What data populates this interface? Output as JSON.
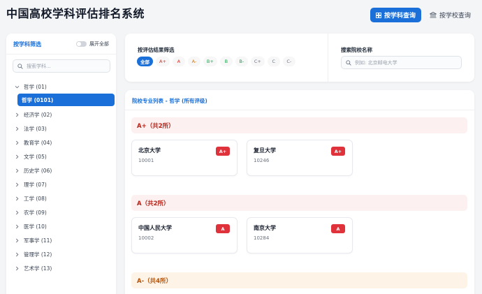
{
  "app": {
    "title": "中国高校学科评估排名系统"
  },
  "nav": {
    "subject_query": "按学科查询",
    "school_query": "按学校查询"
  },
  "sidebar": {
    "title": "按学科筛选",
    "expand_all": "展开全部",
    "search_placeholder": "搜索学科...",
    "tree": [
      {
        "label": "哲学 (01)",
        "expanded": true,
        "children": [
          {
            "label": "哲学 (0101)",
            "selected": true
          }
        ]
      },
      {
        "label": "经济学 (02)"
      },
      {
        "label": "法学 (03)"
      },
      {
        "label": "教育学 (04)"
      },
      {
        "label": "文学 (05)"
      },
      {
        "label": "历史学 (06)"
      },
      {
        "label": "理学 (07)"
      },
      {
        "label": "工学 (08)"
      },
      {
        "label": "农学 (09)"
      },
      {
        "label": "医学 (10)"
      },
      {
        "label": "军事学 (11)"
      },
      {
        "label": "管理学 (12)"
      },
      {
        "label": "艺术学 (13)"
      }
    ]
  },
  "filters": {
    "grade_title": "按评估结果筛选",
    "grades": [
      {
        "label": "全部",
        "active": true,
        "color": "#ffffff"
      },
      {
        "label": "A+",
        "color": "#d92d20"
      },
      {
        "label": "A",
        "color": "#d92d20"
      },
      {
        "label": "A-",
        "color": "#d97706"
      },
      {
        "label": "B+",
        "color": "#16a34a"
      },
      {
        "label": "B",
        "color": "#16a34a"
      },
      {
        "label": "B-",
        "color": "#16a34a"
      },
      {
        "label": "C+",
        "color": "#6b7280"
      },
      {
        "label": "C",
        "color": "#6b7280"
      },
      {
        "label": "C-",
        "color": "#6b7280"
      }
    ],
    "school_search_title": "搜索院校名称",
    "school_search_placeholder": "例如: 北京邮电大学"
  },
  "list": {
    "title": "院校专业列表 - 哲学 (所有评级)",
    "groups": [
      {
        "heading": "A+（共2所）",
        "color": "#b42318",
        "bg": "#fdf0f0",
        "schools": [
          {
            "name": "北京大学",
            "code": "10001",
            "grade": "A+"
          },
          {
            "name": "复旦大学",
            "code": "10246",
            "grade": "A+"
          }
        ]
      },
      {
        "heading": "A（共2所）",
        "color": "#b42318",
        "bg": "#fdf0f0",
        "schools": [
          {
            "name": "中国人民大学",
            "code": "10002",
            "grade": "A"
          },
          {
            "name": "南京大学",
            "code": "10284",
            "grade": "A"
          }
        ]
      },
      {
        "heading": "A-（共4所）",
        "color": "#b45309",
        "bg": "#fdf3e7",
        "schools": []
      }
    ],
    "badge_color": "#e0323b"
  }
}
